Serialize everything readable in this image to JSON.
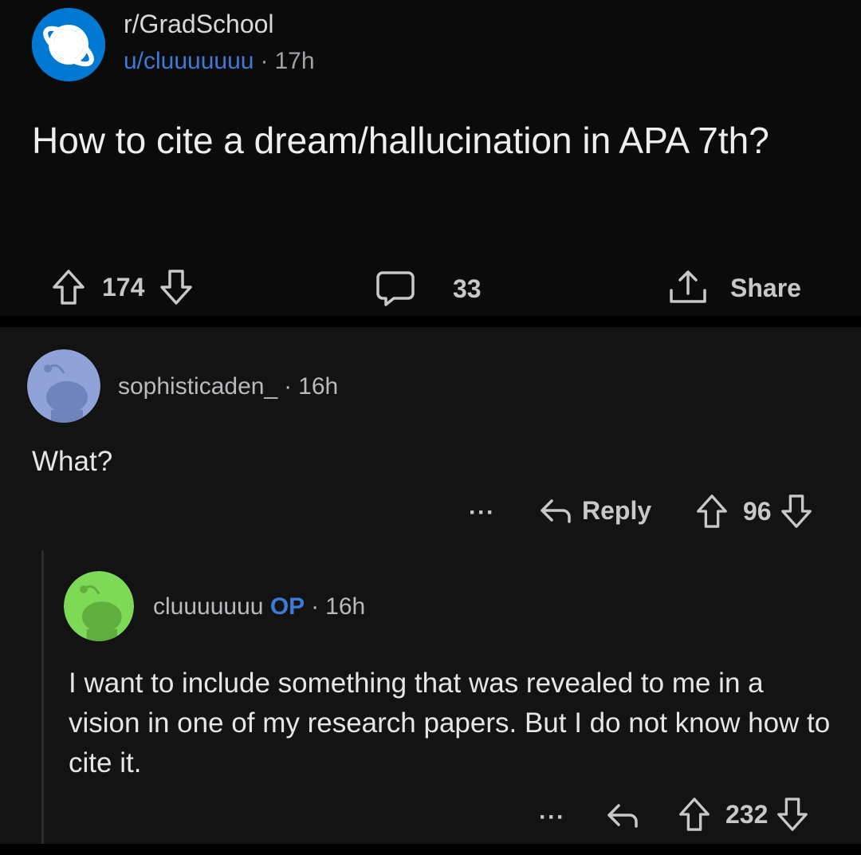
{
  "post": {
    "subreddit": "r/GradSchool",
    "author": "u/cluuuuuuu",
    "separator": "·",
    "age": "17h",
    "title": "How to cite a dream/hallucination in APA 7th?",
    "upvotes": "174",
    "comments": "33",
    "share_label": "Share"
  },
  "comments": [
    {
      "username": "sophisticaden_",
      "separator": "·",
      "age": "16h",
      "body": "What?",
      "more": "···",
      "reply_label": "Reply",
      "score": "96",
      "avatar_color": "#8fa3d8"
    },
    {
      "username": "cluuuuuuu",
      "op_badge": "OP",
      "separator": "·",
      "age": "16h",
      "body": "I want to include something that was revealed to me in a vision in one of my research papers. But I do not know how to cite it.",
      "more": "···",
      "score": "232",
      "avatar_color": "#7ed957"
    }
  ],
  "colors": {
    "post_background": "#0b0b0c",
    "comment_background": "#131314",
    "link_blue": "#3d7bd6",
    "subreddit_icon": "#0079d3"
  }
}
